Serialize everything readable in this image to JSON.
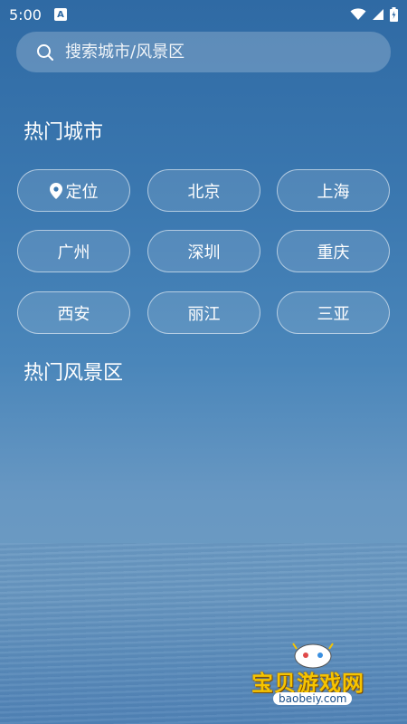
{
  "status_bar": {
    "time": "5:00",
    "notification_icon_glyph": "A"
  },
  "search": {
    "placeholder": "搜索城市/风景区"
  },
  "hot_cities": {
    "title": "热门城市",
    "items": [
      {
        "label": "定位",
        "icon": "location-pin-icon"
      },
      {
        "label": "北京"
      },
      {
        "label": "上海"
      },
      {
        "label": "广州"
      },
      {
        "label": "深圳"
      },
      {
        "label": "重庆"
      },
      {
        "label": "西安"
      },
      {
        "label": "丽江"
      },
      {
        "label": "三亚"
      }
    ]
  },
  "hot_scenic": {
    "title": "热门风景区"
  },
  "watermark": {
    "brand": "宝贝游戏网",
    "url": "baobeiy.com"
  }
}
